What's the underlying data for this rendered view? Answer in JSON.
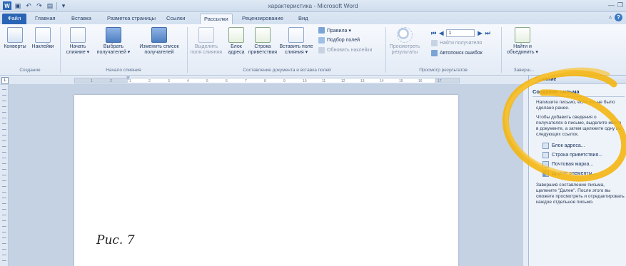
{
  "window": {
    "title": "характеристика - Microsoft Word"
  },
  "qat": {
    "icons": [
      "word-icon",
      "save-icon",
      "undo-icon",
      "redo-icon",
      "print-icon",
      "customize-icon"
    ],
    "glyph_undo": "↶",
    "glyph_redo": "↷",
    "glyph_save": "▣",
    "glyph_print": "▤",
    "glyph_more": "▾"
  },
  "tabs": {
    "file": "Файл",
    "home": "Главная",
    "insert": "Вставка",
    "layout": "Разметка страницы",
    "refs": "Ссылки",
    "mailings": "Рассылки",
    "review": "Рецензирование",
    "view": "Вид"
  },
  "ribbon": {
    "create": {
      "envelopes": "Конверты",
      "labels": "Наклейки",
      "group": "Создание"
    },
    "start_merge": {
      "start_l1": "Начать",
      "start_l2": "слияние ▾",
      "select_l1": "Выбрать",
      "select_l2": "получателей ▾",
      "edit_l1": "Изменить список",
      "edit_l2": "получателей",
      "group": "Начало слияния"
    },
    "fields": {
      "highlight_l1": "Выделить",
      "highlight_l2": "поля слияния",
      "address_l1": "Блок",
      "address_l2": "адреса",
      "greeting_l1": "Строка",
      "greeting_l2": "приветствия",
      "insert_l1": "Вставить поле",
      "insert_l2": "слияния ▾",
      "rules": "Правила ▾",
      "match": "Подбор полей",
      "update": "Обновить наклейки",
      "group": "Составление документа и вставка полей"
    },
    "preview": {
      "preview_l1": "Просмотреть",
      "preview_l2": "результаты",
      "record": "1",
      "find": "Найти получателя",
      "errors": "Автопоиск ошибок",
      "group": "Просмотр результатов"
    },
    "finish": {
      "finish_l1": "Найти и",
      "finish_l2": "объединить ▾",
      "group": "Заверш..."
    }
  },
  "ruler": {
    "corner": "L",
    "ticks": [
      "1",
      "2",
      "1",
      "2",
      "3",
      "4",
      "5",
      "6",
      "7",
      "8",
      "9",
      "10",
      "11",
      "12",
      "13",
      "14",
      "15",
      "16",
      "17"
    ]
  },
  "pane": {
    "title": "Слияние",
    "heading": "Создание письма",
    "p1": "Напишите письмо, если это не было сделано ранее.",
    "p2": "Чтобы добавить сведения о получателях в письмо, выделите место в документе, а затем щелкните одну из следующих ссылок.",
    "link_address": "Блок адреса...",
    "link_greeting": "Строка приветствия...",
    "link_postage": "Почтовая марка...",
    "link_other": "Другие элементы...",
    "p3": "Завершив составление письма, щелкните \"Далее\". После этого вы сможете просмотреть и отредактировать каждое отдельное письмо."
  },
  "caption": "Рис. 7",
  "colors": {
    "accent": "#2a65b5",
    "annotation": "#f5b40a",
    "workspace": "#c4d2e4"
  }
}
